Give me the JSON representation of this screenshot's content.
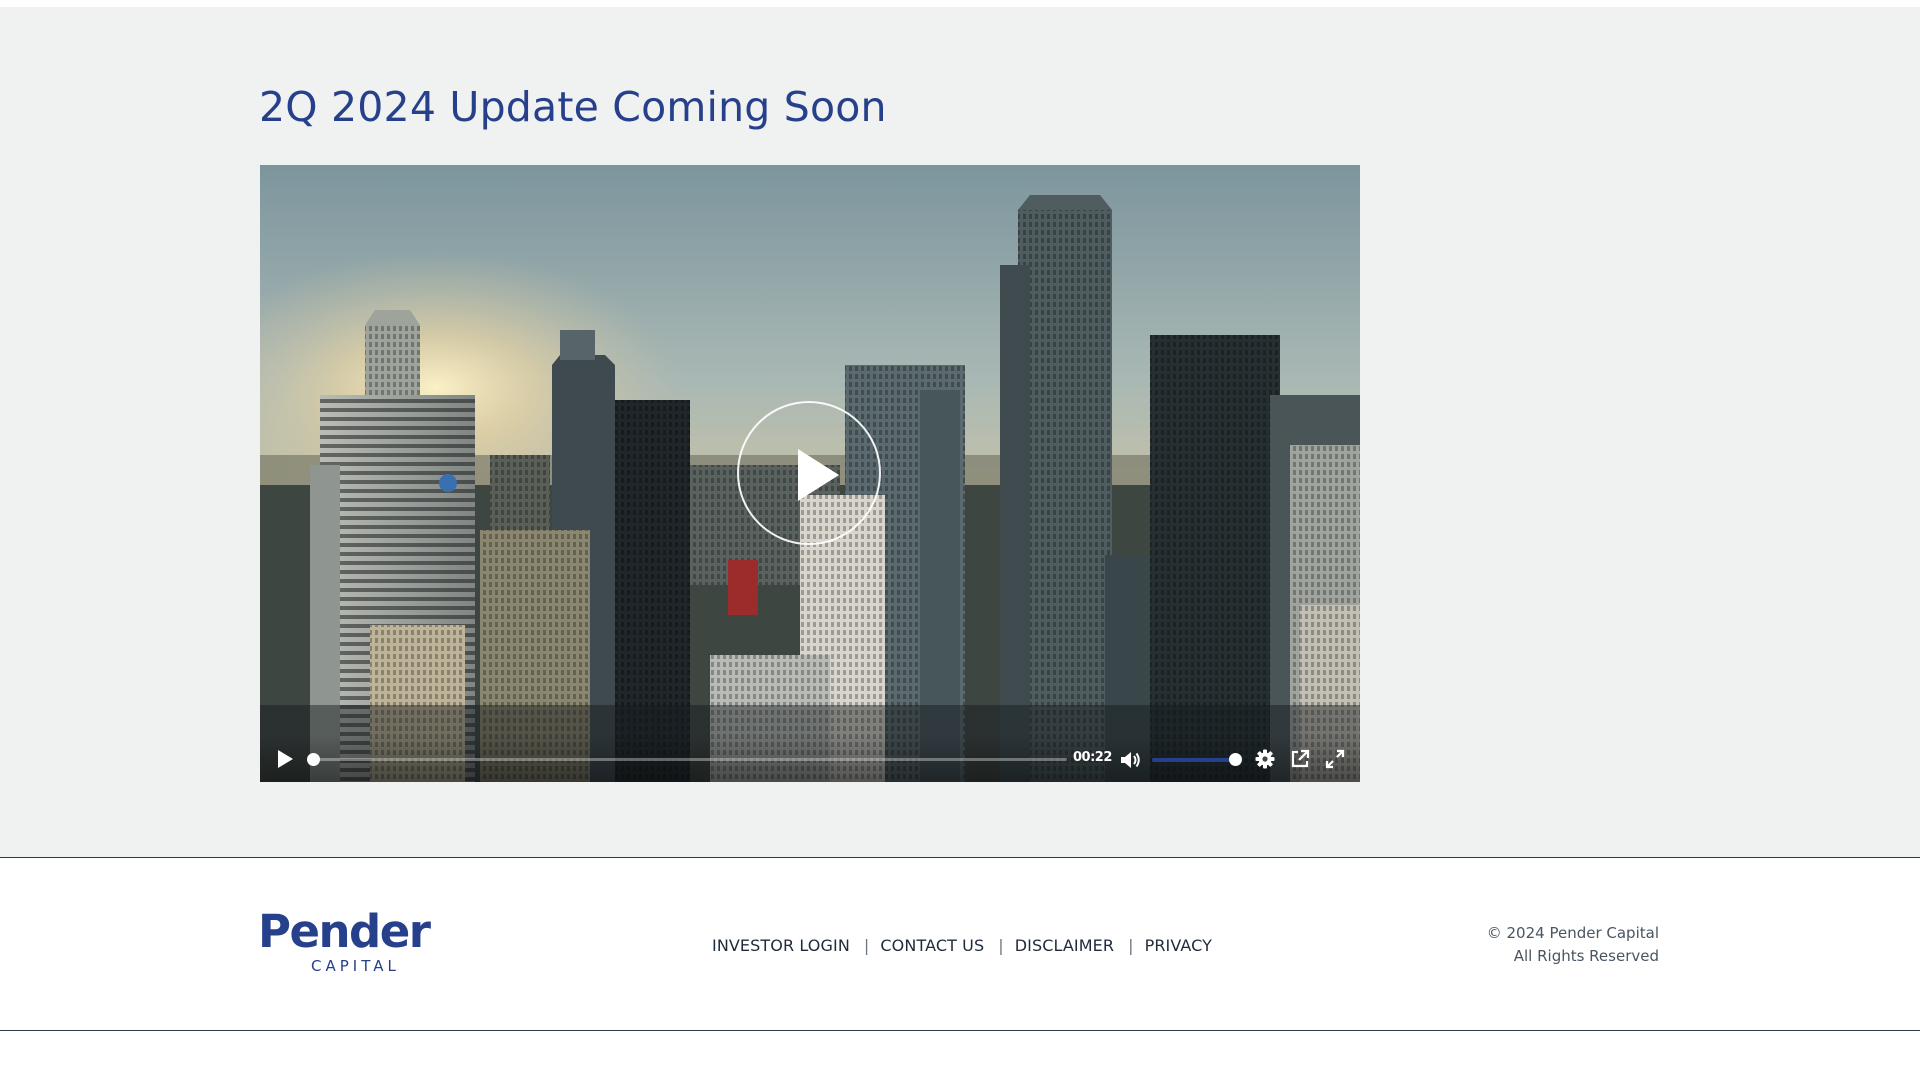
{
  "page": {
    "title": "2Q 2024 Update Coming Soon"
  },
  "video": {
    "current_time": "00:22",
    "progress": 0.0,
    "volume": 1.0,
    "icons": [
      "play-icon",
      "volume-icon",
      "settings-icon",
      "popout-icon",
      "fullscreen-icon"
    ],
    "accent_color": "#27408b"
  },
  "footer": {
    "logo": {
      "word": "Pender",
      "sub": "CAPITAL"
    },
    "nav": [
      {
        "label": "INVESTOR LOGIN"
      },
      {
        "label": "CONTACT US"
      },
      {
        "label": "DISCLAIMER"
      },
      {
        "label": "PRIVACY"
      }
    ],
    "separator": "|",
    "copyright_line1": "© 2024 Pender Capital",
    "copyright_line2": "All Rights Reserved"
  },
  "colors": {
    "brand_blue": "#27408b",
    "page_bg": "#f0f1f1"
  }
}
